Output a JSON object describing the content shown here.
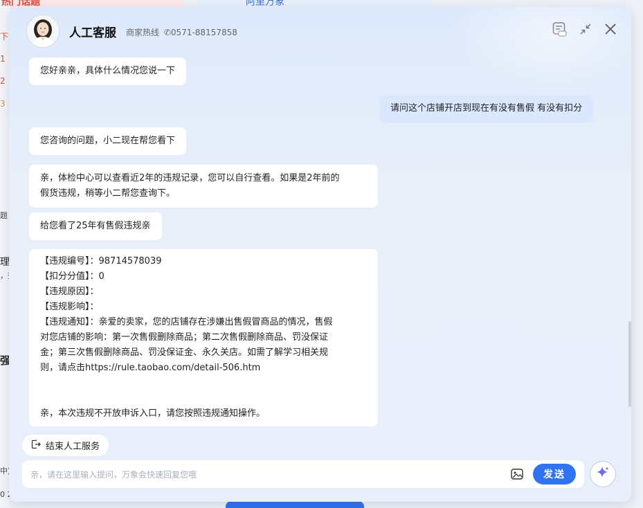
{
  "background": {
    "left_fragments": [
      "下",
      "1",
      "2",
      "3",
      "题",
      "理",
      "，查",
      "强",
      "中)",
      "0 2"
    ],
    "top_left_text": "热门话题",
    "top_right_text": "阿里万象"
  },
  "header": {
    "title": "人工客服",
    "hotline_label": "商家热线",
    "hotline_number": "0571-88157858",
    "action_icons": [
      "feedback-icon",
      "minimize-icon",
      "close-icon"
    ]
  },
  "messages": [
    {
      "role": "agent",
      "lines": [
        "您好亲亲，具体什么情况您说一下"
      ]
    },
    {
      "role": "user",
      "lines": [
        "请问这个店铺开店到现在有没有售假 有没有扣分"
      ]
    },
    {
      "role": "agent",
      "lines": [
        "您咨询的问题，小二现在帮您看下"
      ]
    },
    {
      "role": "agent",
      "lines": [
        "亲，体检中心可以查看近2年的违规记录，您可以自行查看。如果是2年前的",
        "假货违规，稍等小二帮您查询下。"
      ]
    },
    {
      "role": "agent",
      "lines": [
        "给您看了25年有售假违规亲"
      ]
    },
    {
      "role": "agent",
      "lines": [
        "【违规编号】：98714578039",
        "【扣分分值】：0",
        "【违规原因】：",
        "【违规影响】：",
        "【违规通知】：亲爱的卖家，您的店铺存在涉嫌出售假冒商品的情况，售假",
        "对您店铺的影响：第一次售假删除商品；第二次售假删除商品、罚没保证",
        "金；第三次售假删除商品、罚没保证金、永久关店。如需了解学习相关规",
        "则，请点击https://rule.taobao.com/detail-506.htm",
        "",
        "",
        "亲，本次违规不开放申诉入口，请您按照违规通知操作。"
      ]
    }
  ],
  "footer": {
    "end_service_label": "结束人工服务",
    "input_placeholder": "亲，请在这里输入提问，万象会快速回复您哦",
    "input_value": "",
    "send_label": "发送"
  },
  "colors": {
    "accent": "#2f74f4",
    "user_bubble": "#dbe7fc",
    "agent_bubble": "#ffffff"
  }
}
